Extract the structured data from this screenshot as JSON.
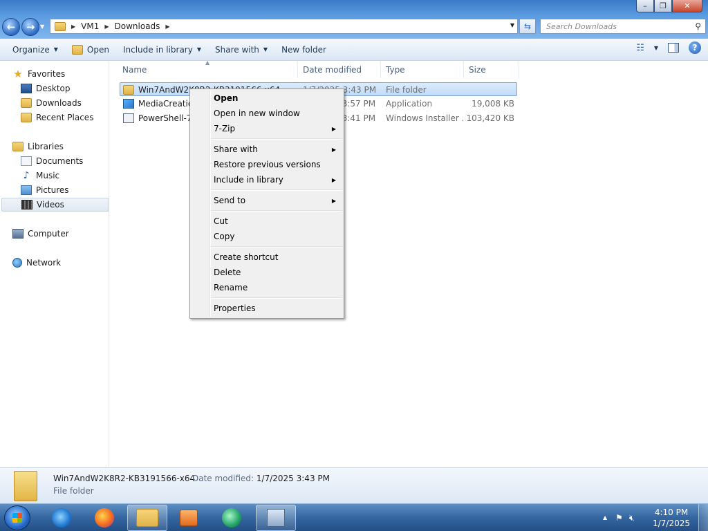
{
  "window": {
    "controls": {
      "minimize": "–",
      "maximize": "❐",
      "close": "✕"
    }
  },
  "address": {
    "crumbs": [
      "VM1",
      "Downloads"
    ],
    "search_placeholder": "Search Downloads"
  },
  "toolbar": {
    "organize": "Organize",
    "open": "Open",
    "include_in_library": "Include in library",
    "share_with": "Share with",
    "new_folder": "New folder"
  },
  "nav": {
    "favorites": "Favorites",
    "desktop": "Desktop",
    "downloads": "Downloads",
    "recent_places": "Recent Places",
    "libraries": "Libraries",
    "documents": "Documents",
    "music": "Music",
    "pictures": "Pictures",
    "videos": "Videos",
    "computer": "Computer",
    "network": "Network"
  },
  "columns": {
    "name": "Name",
    "date_modified": "Date modified",
    "type": "Type",
    "size": "Size"
  },
  "files": [
    {
      "name": "Win7AndW2K8R2-KB3191566-x64",
      "date": "1/7/2025 3:43 PM",
      "type": "File folder",
      "size": ""
    },
    {
      "name": "MediaCreationTool",
      "date": "1/7/2025 3:57 PM",
      "type": "Application",
      "size": "19,008 KB"
    },
    {
      "name": "PowerShell-7.2",
      "date": "1/7/2025 3:41 PM",
      "type": "Windows Installer ...",
      "size": "103,420 KB"
    }
  ],
  "context_menu": {
    "open": "Open",
    "open_new_window": "Open in new window",
    "seven_zip": "7-Zip",
    "share_with": "Share with",
    "restore_previous": "Restore previous versions",
    "include_in_library": "Include in library",
    "send_to": "Send to",
    "cut": "Cut",
    "copy": "Copy",
    "create_shortcut": "Create shortcut",
    "delete": "Delete",
    "rename": "Rename",
    "properties": "Properties"
  },
  "details": {
    "name": "Win7AndW2K8R2-KB3191566-x64",
    "modified_label": "Date modified:",
    "modified_value": "1/7/2025 3:43 PM",
    "type": "File folder"
  },
  "taskbar": {
    "time": "4:10 PM",
    "date": "1/7/2025"
  },
  "colors": {
    "selection": "#cde4fb",
    "taskbar": "#3566a0",
    "titlebar": "#5b9be0"
  }
}
